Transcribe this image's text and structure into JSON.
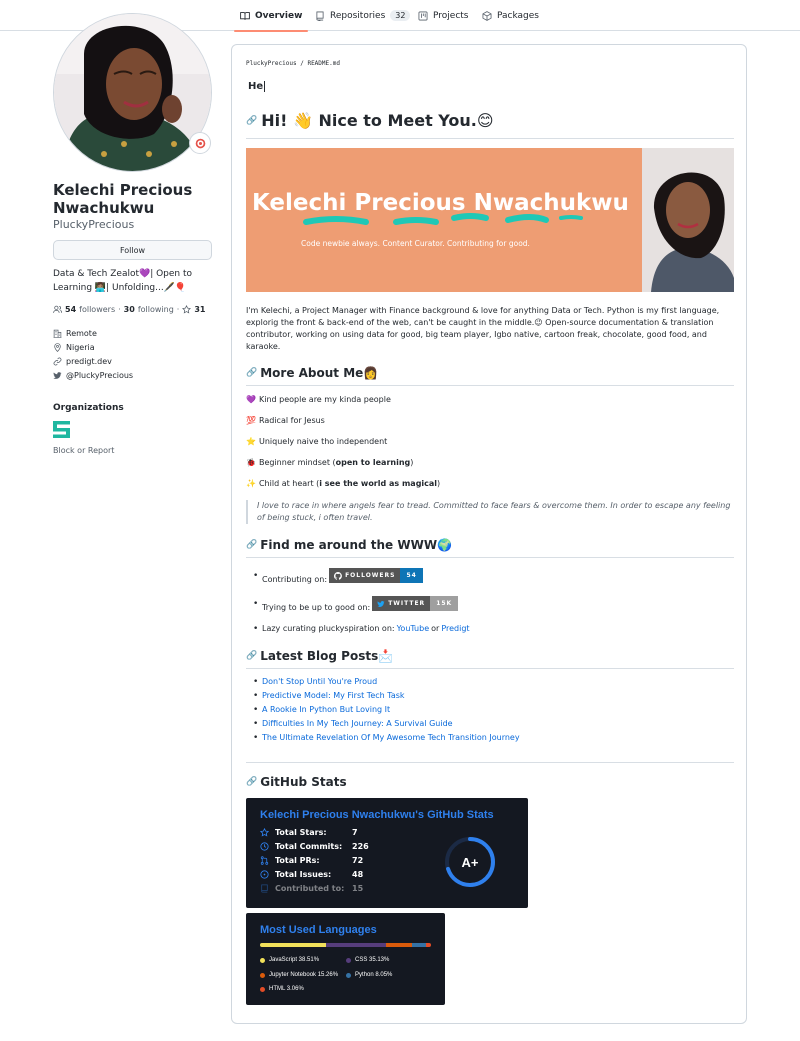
{
  "nav": {
    "tabs": [
      {
        "label": "Overview"
      },
      {
        "label": "Repositories",
        "count": "32"
      },
      {
        "label": "Projects"
      },
      {
        "label": "Packages"
      }
    ]
  },
  "profile": {
    "full_name": "Kelechi Precious Nwachukwu",
    "username": "PluckyPrecious",
    "follow_label": "Follow",
    "bio": "Data & Tech Zealot💜| Open to Learning 👩🏽‍💻| Unfolding...🖋️🎈",
    "followers_count": "54",
    "followers_label": "followers",
    "following_count": "30",
    "following_label": "following",
    "stars_count": "31",
    "location_work": "Remote",
    "location": "Nigeria",
    "website": "predigt.dev",
    "twitter": "@PluckyPrecious",
    "organizations_heading": "Organizations",
    "block_label": "Block or Report"
  },
  "readme": {
    "path_user": "PluckyPrecious",
    "path_sep": "/",
    "path_file": "README.md",
    "typing_text": "He",
    "greeting": "Hi! 👋 Nice to Meet You.😊",
    "banner": {
      "title": "Kelechi Precious Nwachukwu",
      "tagline": "Code newbie always. Content Curator. Contributing for good."
    },
    "intro": "I'm Kelechi, a Project Manager with Finance background & love for anything Data or Tech. Python is my first language, explorig the front & back-end of the web, can't be caught in the middle.😉 Open-source documentation & translation contributor, working on using data for good, big team player, Igbo native, cartoon freak, chocolate, good food, and karaoke.",
    "about_heading": "More About Me👩",
    "about": [
      {
        "emoji": "💜",
        "text": "Kind people are my kinda people"
      },
      {
        "emoji": "💯",
        "text": "Radical for Jesus"
      },
      {
        "emoji": "⭐",
        "text": "Uniquely naive tho independent"
      },
      {
        "emoji": "🐞",
        "pre": "Beginner mindset (",
        "bold": "open to learning",
        "post": ")"
      },
      {
        "emoji": "✨",
        "pre": "Child at heart (",
        "bold": "i see the world as magical",
        "post": ")"
      }
    ],
    "quote": "I love to race in where angels fear to tread. Committed to face fears & overcome them. In order to escape any feeling of being stuck, i often travel.",
    "find_heading": "Find me around the WWW🌍",
    "contributing_label": "Contributing on:",
    "github_badge": {
      "label": "FOLLOWERS",
      "value": "54"
    },
    "trying_label": "Trying to be up to good on:",
    "twitter_badge": {
      "label": "TWITTER",
      "value": "15K"
    },
    "lazy_label": "Lazy curating pluckyspiration on:",
    "youtube_link": "YouTube",
    "or_text": "or",
    "predigt_link": "Predigt",
    "blog_heading": "Latest Blog Posts📩",
    "posts": [
      "Don't Stop Until You're Proud",
      "Predictive Model: My First Tech Task",
      "A Rookie In Python But Loving It",
      "Difficulties In My Tech Journey: A Survival Guide",
      "The Ultimate Revelation Of My Awesome Tech Transition Journey"
    ],
    "stats_heading": "GitHub Stats",
    "stats_card": {
      "title": "Kelechi Precious Nwachukwu's GitHub Stats",
      "rows": [
        {
          "label": "Total Stars:",
          "value": "7"
        },
        {
          "label": "Total Commits:",
          "value": "226"
        },
        {
          "label": "Total PRs:",
          "value": "72"
        },
        {
          "label": "Total Issues:",
          "value": "48"
        },
        {
          "label": "Contributed to:",
          "value": "15"
        }
      ],
      "grade": "A+",
      "grade_progress": 0.7
    },
    "langs_card": {
      "title": "Most Used Languages",
      "languages": [
        {
          "name": "JavaScript",
          "percent": 38.51,
          "label": "JavaScript 38.51%",
          "color": "#f1e05a"
        },
        {
          "name": "CSS",
          "percent": 35.13,
          "label": "CSS 35.13%",
          "color": "#563d7c"
        },
        {
          "name": "Jupyter Notebook",
          "percent": 15.26,
          "label": "Jupyter Notebook 15.26%",
          "color": "#da5b0b"
        },
        {
          "name": "Python",
          "percent": 8.05,
          "label": "Python 8.05%",
          "color": "#3572a5"
        },
        {
          "name": "HTML",
          "percent": 3.06,
          "label": "HTML 3.06%",
          "color": "#e34c26"
        }
      ]
    }
  }
}
